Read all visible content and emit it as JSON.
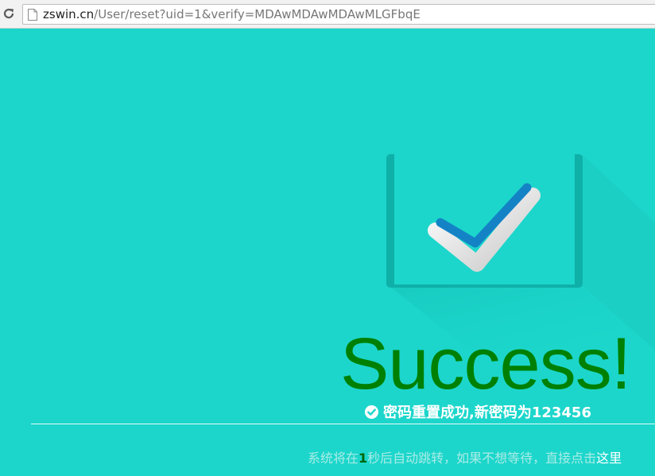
{
  "browser": {
    "url_host": "zswin.cn",
    "url_path": "/User/reset?uid=1&verify=MDAwMDAwMDAwMLGFbqE",
    "icons": {
      "reload": "reload-icon",
      "page": "page-icon"
    }
  },
  "main": {
    "title": "Success!",
    "message": "密码重置成功,新密码为123456",
    "message_icon": "check-circle-icon",
    "illustration_icon": "checkmark-card-icon",
    "redirect": {
      "prefix": "系统将在",
      "seconds": "1",
      "middle": "秒后自动跳转，如果不想等待，直接点击",
      "link_text": "这里"
    }
  },
  "colors": {
    "background": "#1cd6cb",
    "title": "#008000",
    "countdown": "#006400",
    "card_shadow": "#0fb0a8",
    "check_blue": "#1483c6"
  }
}
